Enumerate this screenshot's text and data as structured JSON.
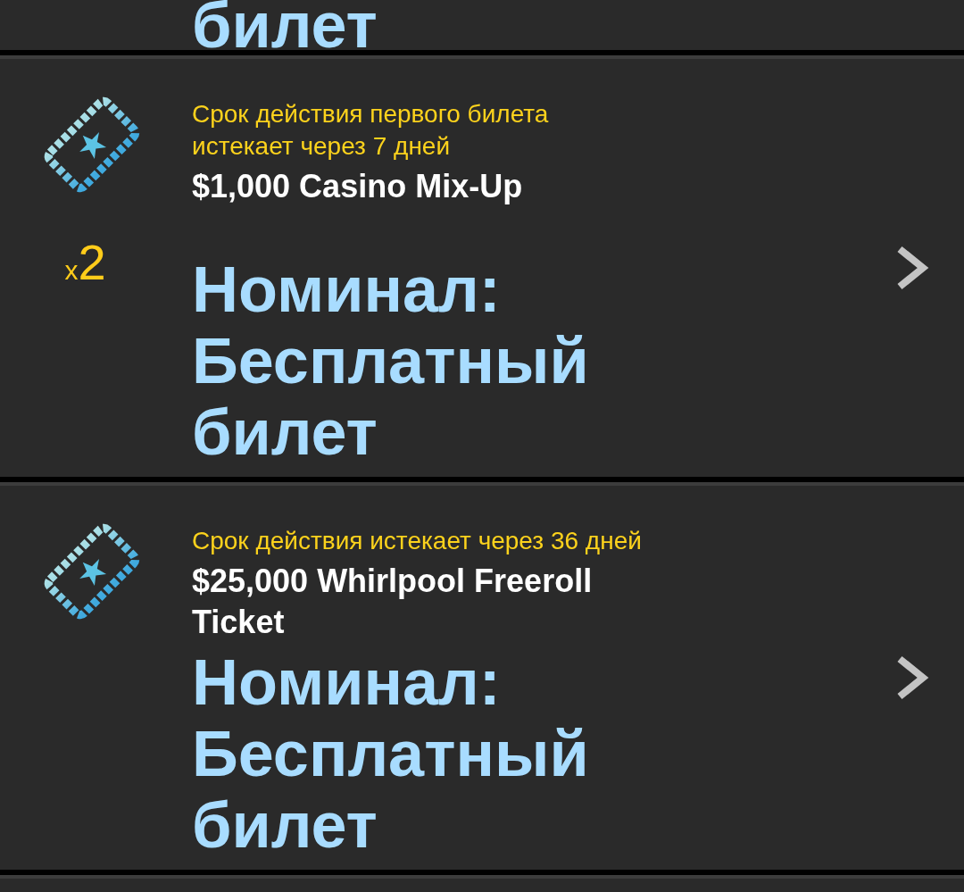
{
  "top_card": {
    "nominal_tail": "билет"
  },
  "tickets": [
    {
      "expiry": "Срок действия первого билета\nистекает через 7 дней",
      "title": "$1,000 Casino Mix-Up",
      "count_prefix": "x",
      "count": "2",
      "nominal": "Номинал: Бесплатный билет"
    },
    {
      "expiry": "Срок действия истекает через 36 дней",
      "title": "$25,000 Whirlpool Freeroll Ticket",
      "nominal": "Номинал: Бесплатный билет"
    }
  ]
}
